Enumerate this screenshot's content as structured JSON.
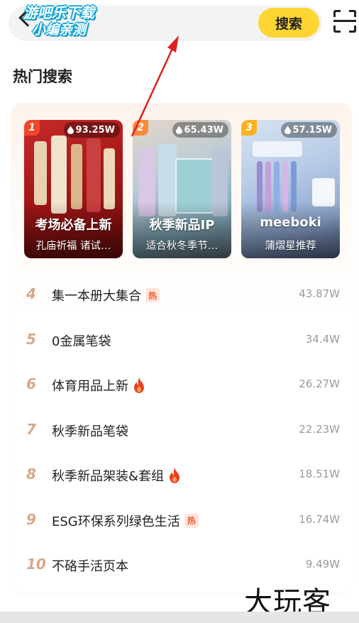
{
  "header": {
    "search_label": "搜索",
    "back_icon": "chevron-left-icon",
    "scan_icon": "scan-icon"
  },
  "watermark_top": {
    "line1": "游吧乐下载",
    "line2": "小编亲测"
  },
  "watermark_bottom": "大玩客",
  "hot_search": {
    "title": "热门搜索",
    "cards": [
      {
        "rank": "1",
        "heat": "93.25W",
        "title": "考场必备上新",
        "subtitle": "孔庙祈福 诸试…"
      },
      {
        "rank": "2",
        "heat": "65.43W",
        "title": "秋季新品IP",
        "subtitle": "适合秋冬季节…"
      },
      {
        "rank": "3",
        "heat": "57.15W",
        "title": "meeboki",
        "subtitle": "蒲熠星推荐"
      }
    ],
    "list": [
      {
        "rank": "4",
        "label": "集一本册大集合",
        "badge": "热",
        "heat": "43.87W"
      },
      {
        "rank": "5",
        "label": "0金属笔袋",
        "badge": "",
        "heat": "34.4W"
      },
      {
        "rank": "6",
        "label": "体育用品上新",
        "badge": "fire-icon",
        "heat": "26.27W"
      },
      {
        "rank": "7",
        "label": "秋季新品笔袋",
        "badge": "",
        "heat": "22.23W"
      },
      {
        "rank": "8",
        "label": "秋季新品架装&套组",
        "badge": "fire-icon",
        "heat": "18.51W"
      },
      {
        "rank": "9",
        "label": "ESG环保系列绿色生活",
        "badge": "热",
        "heat": "16.74W"
      },
      {
        "rank": "10",
        "label": "不硌手活页本",
        "badge": "",
        "heat": "9.49W"
      }
    ]
  },
  "colors": {
    "accent_yellow": "#ffd533",
    "rank_number": "#d6a88a",
    "hot_tag": "#f0602e",
    "annotation_arrow": "#e02020"
  }
}
